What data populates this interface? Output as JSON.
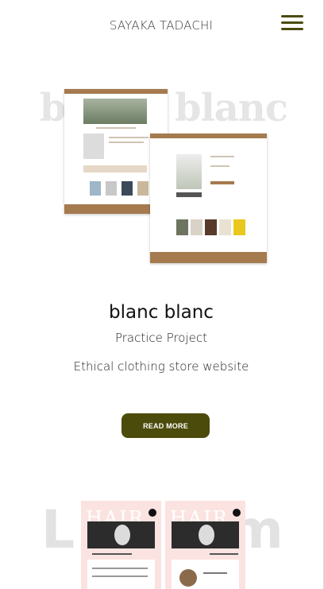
{
  "header": {
    "site_title": "SAYAKA TADACHI",
    "menu_icon": "hamburger-menu-icon"
  },
  "project1": {
    "bg_word_left": "b",
    "bg_word_right": "blanc",
    "title": "blanc blanc",
    "subtitle": "Practice Project",
    "description": "Ethical clothing store website",
    "cta_label": "READ MORE"
  },
  "project2": {
    "bg_word_left": "L",
    "bg_word_right": "m",
    "logo_left": "HAIR",
    "logo_right": "HAIR"
  },
  "colors": {
    "accent": "#4b4b0c",
    "mock_brand": "#a57a4e",
    "phone_bg": "#fbe3e1"
  }
}
